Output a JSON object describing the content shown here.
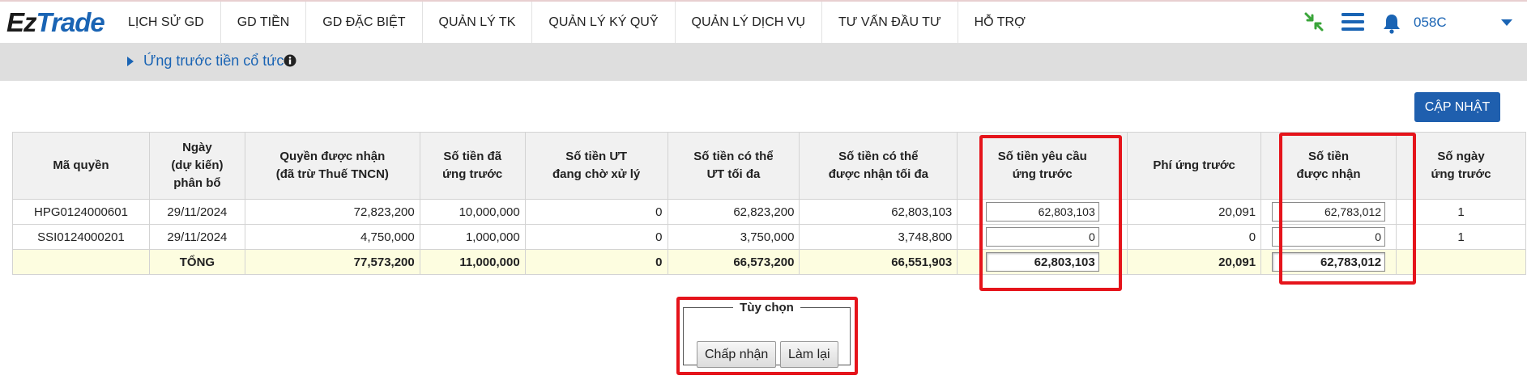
{
  "brand": {
    "part1": "Ez",
    "part2": "Trade"
  },
  "nav": {
    "items": [
      "LỊCH SỬ GD",
      "GD TIỀN",
      "GD ĐẶC BIỆT",
      "QUẢN LÝ TK",
      "QUẢN LÝ KÝ QUỸ",
      "QUẢN LÝ DỊCH VỤ",
      "TƯ VẤN ĐẦU TƯ",
      "HỖ TRỢ"
    ]
  },
  "topright": {
    "account": "058C",
    "icons": [
      "collapse-arrows-icon",
      "menu-icon",
      "bell-icon",
      "caret-down-icon"
    ],
    "colors": {
      "collapse": "#3aa53a",
      "brand": "#1a64b4"
    }
  },
  "subheader": {
    "title": "Ứng trước tiền cổ tức"
  },
  "actions": {
    "update": "CẬP NHẬT"
  },
  "table": {
    "headers": {
      "h0": "Mã quyền",
      "h1_l1": "Ngày",
      "h1_l2": "(dự kiến)",
      "h1_l3": "phân bổ",
      "h2_l1": "Quyền được nhận",
      "h2_l2": "(đã trừ Thuế TNCN)",
      "h3_l1": "Số tiền đã",
      "h3_l2": "ứng trước",
      "h4_l1": "Số tiền ƯT",
      "h4_l2": "đang chờ xử lý",
      "h5_l1": "Số tiền có thể",
      "h5_l2": "ƯT tối đa",
      "h6_l1": "Số tiền có thể",
      "h6_l2": "được nhận tối đa",
      "h7_l1": "Số tiền yêu cầu",
      "h7_l2": "ứng trước",
      "h8": "Phí ứng trước",
      "h9_l1": "Số tiền",
      "h9_l2": "được nhận",
      "h10_l1": "Số ngày",
      "h10_l2": "ứng trước"
    },
    "rows": [
      {
        "code": "HPG0124000601",
        "date": "29/11/2024",
        "entitled": "72,823,200",
        "advanced": "10,000,000",
        "pending": "0",
        "max_adv": "62,823,200",
        "max_recv": "62,803,103",
        "request": "62,803,103",
        "fee": "20,091",
        "received": "62,783,012",
        "days": "1"
      },
      {
        "code": "SSI0124000201",
        "date": "29/11/2024",
        "entitled": "4,750,000",
        "advanced": "1,000,000",
        "pending": "0",
        "max_adv": "3,750,000",
        "max_recv": "3,748,800",
        "request": "0",
        "fee": "0",
        "received": "0",
        "days": "1"
      }
    ],
    "total": {
      "label": "TỔNG",
      "entitled": "77,573,200",
      "advanced": "11,000,000",
      "pending": "0",
      "max_adv": "66,573,200",
      "max_recv": "66,551,903",
      "request": "62,803,103",
      "fee": "20,091",
      "received": "62,783,012"
    }
  },
  "options": {
    "legend": "Tùy chọn",
    "accept": "Chấp nhận",
    "reset": "Làm lại"
  },
  "highlight_color": "#e5141b"
}
